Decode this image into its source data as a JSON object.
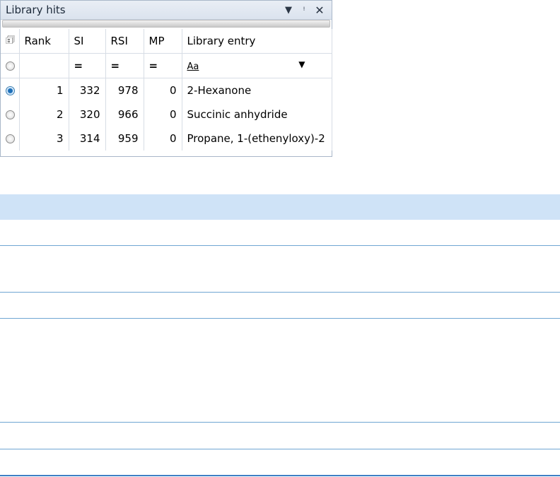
{
  "panel": {
    "title": "Library hits",
    "dropdown_glyph": "▾",
    "pin_glyph": "ᵖ",
    "close_glyph": "✕"
  },
  "columns": {
    "rank": "Rank",
    "si": "SI",
    "rsi": "RSI",
    "mp": "MP",
    "entry": "Library entry"
  },
  "filter": {
    "si": "=",
    "rsi": "=",
    "mp": "=",
    "entry_text": "Aa",
    "entry_dropdown": "▼"
  },
  "rows": [
    {
      "rank": "1",
      "si": "332",
      "rsi": "978",
      "mp": "0",
      "entry": "2-Hexanone",
      "selected": true
    },
    {
      "rank": "2",
      "si": "320",
      "rsi": "966",
      "mp": "0",
      "entry": "Succinic anhydride",
      "selected": false
    },
    {
      "rank": "3",
      "si": "314",
      "rsi": "959",
      "mp": "0",
      "entry": "Propane, 1-(ethenyloxy)-2",
      "selected": false
    }
  ],
  "colors": {
    "header_band": "#cfe3f7",
    "rule": "#6fa6d3",
    "bottom_rule": "#3e7fc4"
  }
}
